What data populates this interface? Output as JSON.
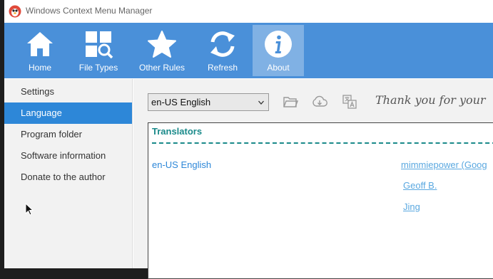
{
  "window": {
    "title": "Windows Context Menu Manager"
  },
  "toolbar": {
    "buttons": [
      {
        "label": "Home",
        "icon": "home-icon"
      },
      {
        "label": "File Types",
        "icon": "file-types-icon"
      },
      {
        "label": "Other Rules",
        "icon": "star-icon"
      },
      {
        "label": "Refresh",
        "icon": "refresh-icon"
      },
      {
        "label": "About",
        "icon": "info-icon",
        "active": true
      }
    ]
  },
  "sidebar": {
    "items": [
      {
        "label": "Settings"
      },
      {
        "label": "Language",
        "active": true
      },
      {
        "label": "Program folder"
      },
      {
        "label": "Software information"
      },
      {
        "label": "Donate to the author"
      }
    ]
  },
  "language": {
    "selected": "en-US English",
    "thanks_text": "Thank you for your"
  },
  "translators": {
    "heading": "Translators",
    "language": "en-US English",
    "names": [
      "mimmiepower (Goog",
      "Geoff B.",
      "Jing"
    ]
  },
  "colors": {
    "toolbar_bg": "#4a90d9",
    "accent": "#2d87d8",
    "heading": "#1a8a8a",
    "link": "#5aa8e0"
  }
}
